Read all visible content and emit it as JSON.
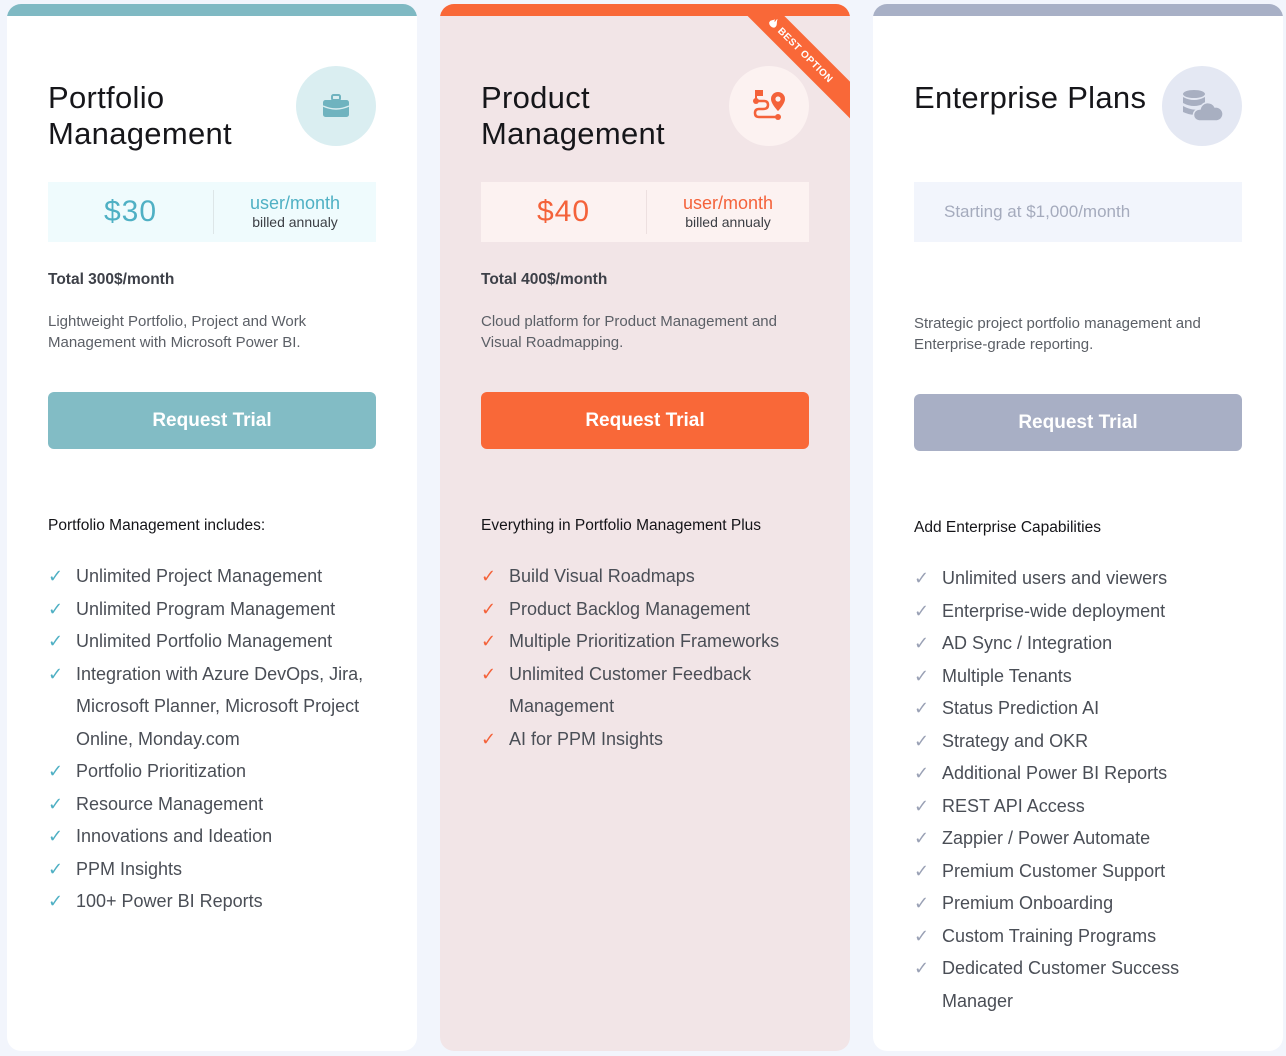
{
  "plans": [
    {
      "title": "Portfolio Management",
      "icon": "briefcase-icon",
      "price": "$30",
      "per": "user/month",
      "billing": "billed annualy",
      "total": "Total 300$/month",
      "description": "Lightweight Portfolio, Project and Work Management with Microsoft Power BI.",
      "cta": "Request Trial",
      "includes_heading": "Portfolio Management includes:",
      "features": [
        "Unlimited Project Management",
        "Unlimited Program Management",
        "Unlimited Portfolio Management",
        "Integration with Azure DevOps, Jira, Microsoft Planner, Microsoft Project Online, Monday.com",
        "Portfolio Prioritization",
        "Resource Management",
        "Innovations and Ideation",
        "PPM Insights",
        "100+ Power BI Reports"
      ]
    },
    {
      "title": "Product Management",
      "icon": "roadmap-pin-icon",
      "badge": "BEST OPTION",
      "price": "$40",
      "per": "user/month",
      "billing": "billed annualy",
      "total": "Total 400$/month",
      "description": "Cloud platform for Product Management and Visual Roadmapping.",
      "cta": "Request Trial",
      "includes_heading": "Everything in Portfolio Management Plus",
      "features": [
        "Build Visual Roadmaps",
        "Product Backlog Management",
        "Multiple Prioritization Frameworks",
        "Unlimited Customer Feedback Management",
        "AI for PPM Insights"
      ]
    },
    {
      "title": "Enterprise Plans",
      "icon": "database-cloud-icon",
      "price_note": "Starting at $1,000/month",
      "description": "Strategic project portfolio management and Enterprise-grade reporting.",
      "cta": "Request Trial",
      "includes_heading": "Add Enterprise Capabilities",
      "features": [
        "Unlimited users and viewers",
        "Enterprise-wide deployment",
        "AD Sync / Integration",
        "Multiple Tenants",
        "Status Prediction AI",
        "Strategy and OKR",
        "Additional Power BI Reports",
        "REST API Access",
        "Zappier / Power Automate",
        "Premium Customer Support",
        "Premium Onboarding",
        "Custom Training Programs",
        "Dedicated Customer Success Manager"
      ]
    }
  ],
  "colors": {
    "portfolio_accent": "#7fb9c3",
    "product_accent": "#f96838",
    "enterprise_accent": "#a8b0c6"
  },
  "check_glyph": "✓"
}
